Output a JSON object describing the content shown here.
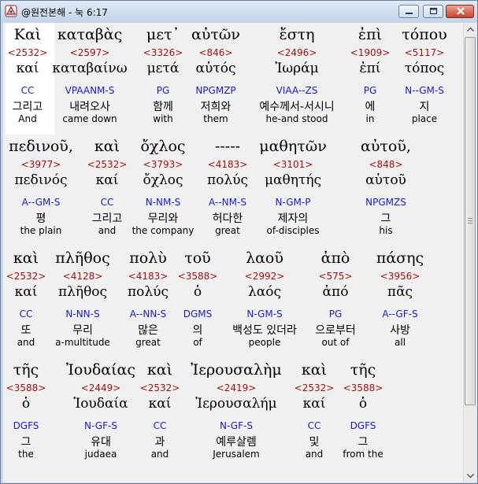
{
  "window": {
    "title": "@원전본해 - 눅 6:17",
    "icon": "bible-app-icon",
    "controls": [
      "minimize-icon",
      "maximize-icon",
      "close-icon"
    ]
  },
  "colors": {
    "strongs": "#a01010",
    "parsing": "#1a1ac8",
    "text": "#000000",
    "highlight_background": "#ffffff",
    "content_background": "#f0f0f0"
  },
  "verse": [
    [
      {
        "greek": "Καὶ",
        "strongs": "<2532>",
        "lexeme": "καί",
        "parsing": "CC",
        "korean": "그리고",
        "english": "And"
      },
      {
        "greek": "καταβὰς",
        "strongs": "<2597>",
        "lexeme": "καταβαίνω",
        "parsing": "VPAANM-S",
        "korean": "내려오사",
        "english": "came down"
      },
      {
        "greek": "μετ᾽",
        "strongs": "<3326>",
        "lexeme": "μετά",
        "parsing": "PG",
        "korean": "함께",
        "english": "with"
      },
      {
        "greek": "αὐτῶν",
        "strongs": "<846>",
        "lexeme": "αὐτός",
        "parsing": "NPGMZP",
        "korean": "저희와",
        "english": "them"
      },
      {
        "greek": "ἔστη",
        "strongs": "<2496>",
        "lexeme": "Ἰωράμ",
        "parsing": "VIAA--ZS",
        "korean": "예수께서-서시니",
        "english": "he-and stood"
      },
      {
        "greek": "ἐπὶ",
        "strongs": "<1909>",
        "lexeme": "ἐπί",
        "parsing": "PG",
        "korean": "에",
        "english": "in"
      },
      {
        "greek": "τόπου",
        "strongs": "<5117>",
        "lexeme": "τόπος",
        "parsing": "N--GM-S",
        "korean": "지",
        "english": "place"
      }
    ],
    [
      {
        "greek": "πεδινοῦ,",
        "strongs": "<3977>",
        "lexeme": "πεδινός",
        "parsing": "A--GM-S",
        "korean": "평",
        "english": "the plain"
      },
      {
        "greek": "καὶ",
        "strongs": "<2532>",
        "lexeme": "καί",
        "parsing": "CC",
        "korean": "그리고",
        "english": "and"
      },
      {
        "greek": "ὄχλος",
        "strongs": "<3793>",
        "lexeme": "ὄχλος",
        "parsing": "N-NM-S",
        "korean": "무리와",
        "english": "the company"
      },
      {
        "greek": "-----",
        "strongs": "<4183>",
        "lexeme": "πολύς",
        "parsing": "A--NM-S",
        "korean": "허다한",
        "english": "great"
      },
      {
        "greek": "μαθητῶν",
        "strongs": "<3101>",
        "lexeme": "μαθητής",
        "parsing": "N-GM-P",
        "korean": "제자의",
        "english": "of-disciples"
      },
      {
        "greek": "αὐτοῦ,",
        "strongs": "<848>",
        "lexeme": "αὑτοῦ",
        "parsing": "NPGMZS",
        "korean": "그",
        "english": "his"
      }
    ],
    [
      {
        "greek": "καὶ",
        "strongs": "<2532>",
        "lexeme": "καί",
        "parsing": "CC",
        "korean": "또",
        "english": "and"
      },
      {
        "greek": "πλῆθος",
        "strongs": "<4128>",
        "lexeme": "πλῆθος",
        "parsing": "N-NN-S",
        "korean": "무리",
        "english": "a-multitude"
      },
      {
        "greek": "πολὺ",
        "strongs": "<4183>",
        "lexeme": "πολύς",
        "parsing": "A--NN-S",
        "korean": "많은",
        "english": "great"
      },
      {
        "greek": "τοῦ",
        "strongs": "<3588>",
        "lexeme": "ὁ",
        "parsing": "DGMS",
        "korean": "의",
        "english": "of"
      },
      {
        "greek": "λαοῦ",
        "strongs": "<2992>",
        "lexeme": "λαός",
        "parsing": "N-GM-S",
        "korean": "백성도 있더라",
        "english": "people"
      },
      {
        "greek": "ἀπὸ",
        "strongs": "<575>",
        "lexeme": "ἀπό",
        "parsing": "PG",
        "korean": "으로부터",
        "english": "out of"
      },
      {
        "greek": "πάσης",
        "strongs": "<3956>",
        "lexeme": "πᾶς",
        "parsing": "A--GF-S",
        "korean": "사방",
        "english": "all"
      }
    ],
    [
      {
        "greek": "τῆς",
        "strongs": "<3588>",
        "lexeme": "ὁ",
        "parsing": "DGFS",
        "korean": "그",
        "english": "the"
      },
      {
        "greek": "Ἰουδαίας",
        "strongs": "<2449>",
        "lexeme": "Ἰουδαία",
        "parsing": "N-GF-S",
        "korean": "유대",
        "english": "judaea"
      },
      {
        "greek": "καὶ",
        "strongs": "<2532>",
        "lexeme": "καί",
        "parsing": "CC",
        "korean": "과",
        "english": "and"
      },
      {
        "greek": "Ἰερουσαλὴμ",
        "strongs": "<2419>",
        "lexeme": "Ἱερουσαλήμ",
        "parsing": "N-GF-S",
        "korean": "예루살렘",
        "english": "Jerusalem"
      },
      {
        "greek": "καὶ",
        "strongs": "<2532>",
        "lexeme": "καί",
        "parsing": "CC",
        "korean": "및",
        "english": "and"
      },
      {
        "greek": "τῆς",
        "strongs": "<3588>",
        "lexeme": "ὁ",
        "parsing": "DGFS",
        "korean": "그",
        "english": "from the"
      }
    ]
  ]
}
